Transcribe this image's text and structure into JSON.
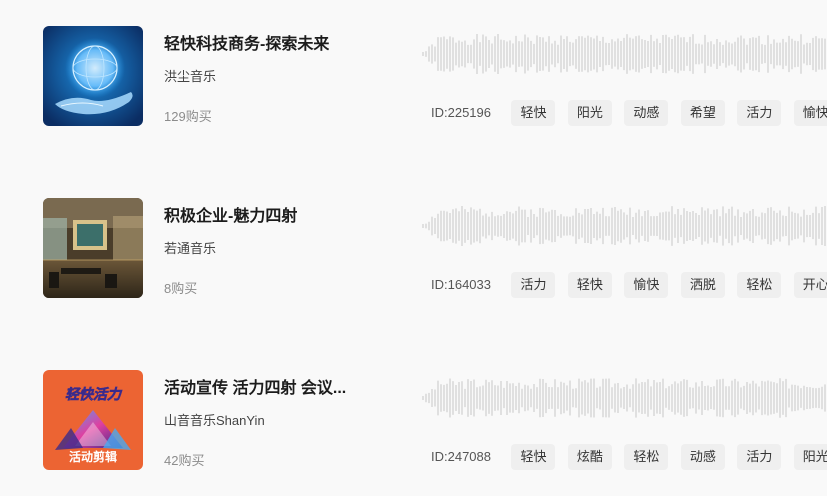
{
  "tracks": [
    {
      "title": "轻快科技商务-探索未来",
      "artist": "洪尘音乐",
      "purchases": "129购买",
      "id_label": "ID:225196",
      "tags": [
        "轻快",
        "阳光",
        "动感",
        "希望",
        "活力",
        "愉快"
      ],
      "cover": {
        "icon": "glowing-globe-hand-icon",
        "colors": [
          "#0b4f96",
          "#1e8fe0",
          "#bfe6ff"
        ]
      }
    },
    {
      "title": "积极企业-魅力四射",
      "artist": "若通音乐",
      "purchases": "8购买",
      "id_label": "ID:164033",
      "tags": [
        "活力",
        "轻快",
        "愉快",
        "洒脱",
        "轻松",
        "开心"
      ],
      "cover": {
        "icon": "office-interior-icon",
        "colors": [
          "#5a4a34",
          "#c8a86a",
          "#3c5f55"
        ]
      }
    },
    {
      "title": "活动宣传 活力四射 会议...",
      "artist": "山音音乐ShanYin",
      "purchases": "42购买",
      "id_label": "ID:247088",
      "tags": [
        "轻快",
        "炫酷",
        "轻松",
        "动感",
        "活力",
        "阳光"
      ],
      "cover": {
        "icon": "event-edit-logo-icon",
        "colors": [
          "#ec6433",
          "#3b2a8a",
          "#e03fa0",
          "#4aa9f0"
        ],
        "top_text": "轻快活力",
        "bottom_text": "活动剪辑"
      }
    }
  ],
  "waveform_color": "#c8c8c8"
}
